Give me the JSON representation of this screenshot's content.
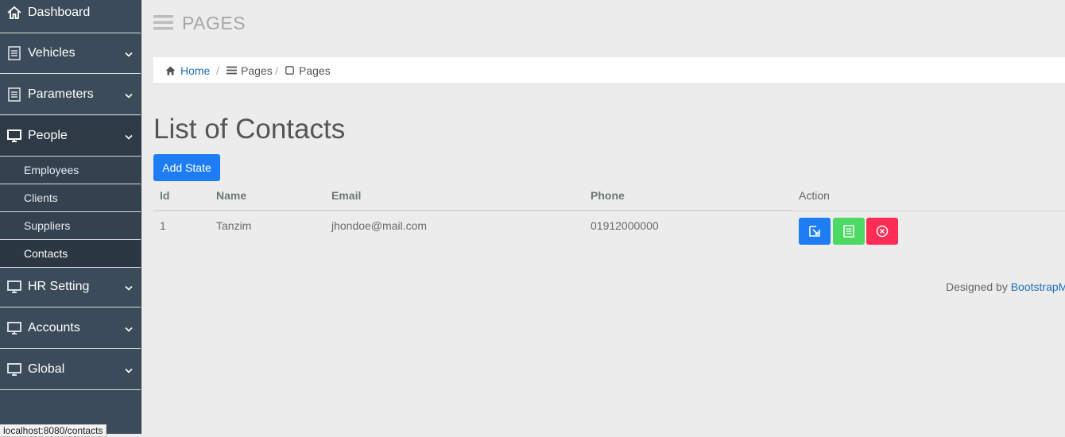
{
  "sidebar": {
    "items": [
      {
        "label": "Dashboard",
        "icon": "home-icon"
      },
      {
        "label": "Vehicles",
        "icon": "document-icon"
      },
      {
        "label": "Parameters",
        "icon": "document-icon"
      },
      {
        "label": "People",
        "icon": "monitor-icon",
        "expanded": true
      },
      {
        "label": "HR Setting",
        "icon": "monitor-icon"
      },
      {
        "label": "Accounts",
        "icon": "monitor-icon"
      },
      {
        "label": "Global",
        "icon": "monitor-icon"
      }
    ],
    "sub_items": [
      {
        "label": "Employees"
      },
      {
        "label": "Clients"
      },
      {
        "label": "Suppliers"
      },
      {
        "label": "Contacts",
        "active": true
      }
    ]
  },
  "header": {
    "title": "PAGES"
  },
  "breadcrumb": {
    "home": "Home",
    "level2": "Pages",
    "level3": "Pages",
    "separator": "/"
  },
  "main": {
    "heading": "List of Contacts",
    "add_button": "Add State"
  },
  "table": {
    "columns": [
      "Id",
      "Name",
      "Email",
      "Phone",
      "Action"
    ],
    "rows": [
      {
        "id": "1",
        "name": "Tanzim",
        "email": "jhondoe@mail.com",
        "phone": "01912000000"
      }
    ],
    "action_icons": [
      "edit-icon",
      "view-icon",
      "delete-icon"
    ]
  },
  "footer": {
    "prefix": "Designed by",
    "link": "BootstrapM"
  },
  "status_bar": {
    "url": "localhost:8080/contacts"
  },
  "colors": {
    "sidebar": "#3c4b59",
    "primary": "#1e7cf5",
    "success": "#4cd964",
    "danger": "#ff2d55"
  }
}
